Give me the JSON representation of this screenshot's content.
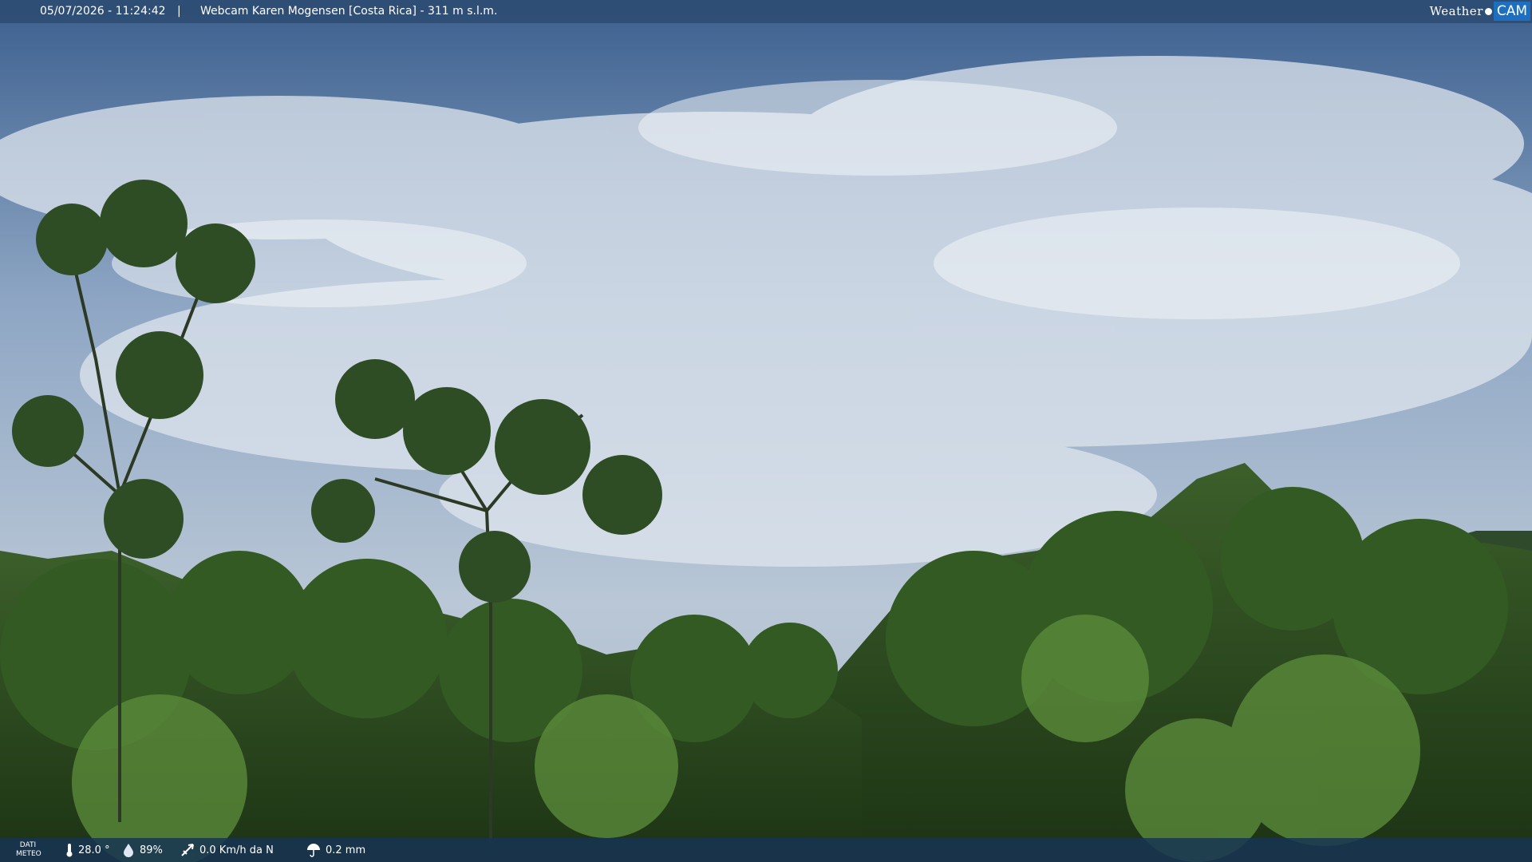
{
  "overlay": {
    "datetime": "05/07/2026 - 11:24:42",
    "separator": "|",
    "title": "Webcam Karen Mogensen [Costa Rica]  - 311 m s.l.m.",
    "logo_weather": "Weather",
    "logo_cam": "CAM"
  },
  "weather_data": {
    "label_line1": "DATI",
    "label_line2": "METEO",
    "temperature": "28.0 °",
    "humidity": "89%",
    "wind": "0.0 Km/h da N",
    "rain": "0.2 mm"
  },
  "colors": {
    "sky_top": "#3b5f8e",
    "sky_bottom": "#b9c7d6",
    "forest_dark": "#1f3a17",
    "forest_light": "#4f7a33",
    "logo_accent": "#1e6fc0"
  }
}
